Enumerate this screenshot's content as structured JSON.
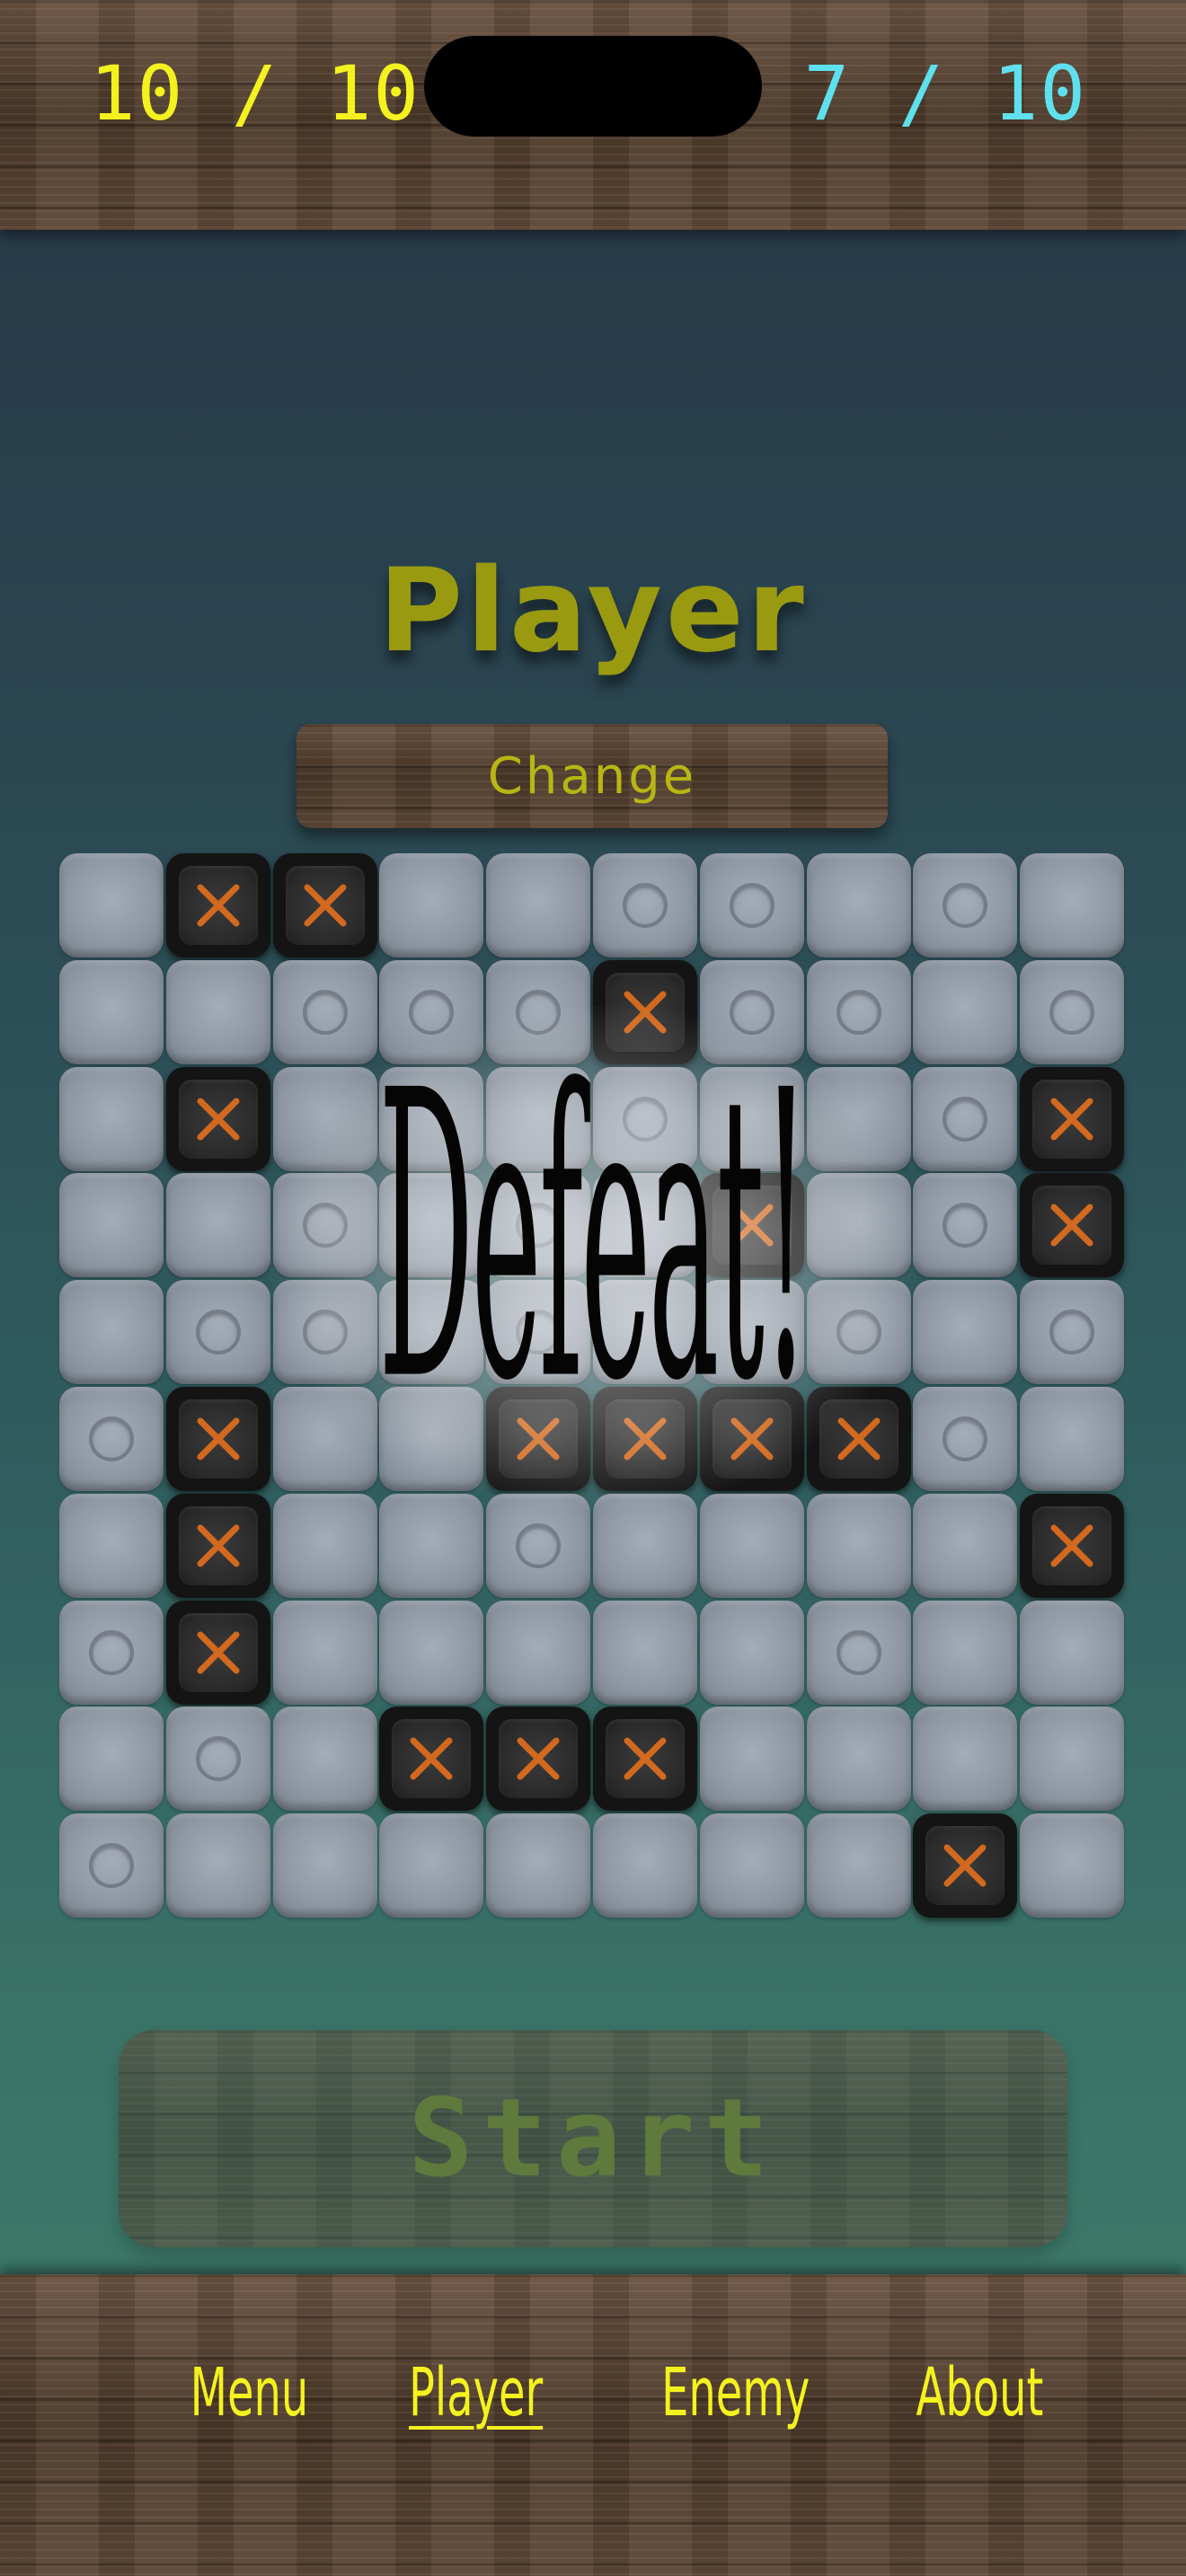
{
  "header": {
    "player_score": "10 / 10",
    "enemy_score": "7 / 10"
  },
  "title": "Player",
  "change_button_label": "Change",
  "result_text": "Defeat!",
  "start_button_label": "Start",
  "nav": [
    {
      "label": "Menu",
      "active": false
    },
    {
      "label": "Player",
      "active": true
    },
    {
      "label": "Enemy",
      "active": false
    },
    {
      "label": "About",
      "active": false
    }
  ],
  "board": {
    "rows": 10,
    "cols": 10,
    "legend": {
      ".": "empty",
      "o": "miss",
      "x": "hit"
    },
    "cells": [
      ".xx..oo.o.",
      "..ooox oo.o",
      ".x...o..ox",
      "..o.o.x.ox",
      ".oo.o..o.o",
      "ox..xxxxo.",
      ".x..o....x",
      "ox.....o..",
      ".o.xxx....",
      "o.......x."
    ]
  },
  "colors": {
    "player_accent": "#f4f21e",
    "enemy_accent": "#5fe0ee",
    "title": "#9a9a10",
    "hit_mark": "#d2691e"
  }
}
